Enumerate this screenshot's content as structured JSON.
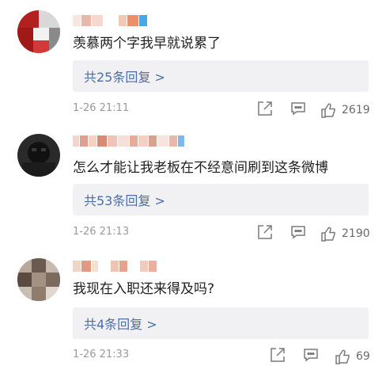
{
  "comments": [
    {
      "text": "羡慕两个字我早就说累了",
      "replies": "共25条回复 >",
      "time": "1-26 21:11",
      "likes": "2619"
    },
    {
      "text": "怎么才能让我老板在不经意间刷到这条微博",
      "replies": "共53条回复 >",
      "time": "1-26 21:13",
      "likes": "2190"
    },
    {
      "text": "我现在入职还来得及吗?",
      "replies": "共4条回复 >",
      "time": "1-26 21:33",
      "likes": "69"
    }
  ],
  "icons": {
    "share": "share-icon",
    "comment": "comment-icon",
    "like": "thumbs-up-icon"
  }
}
